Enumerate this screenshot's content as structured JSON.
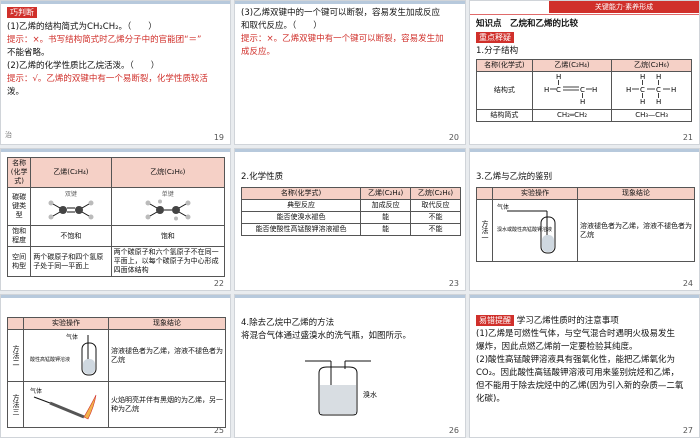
{
  "slides": [
    {
      "num": "19",
      "tag": "巧判断",
      "lines": [
        "(1)乙烯的结构简式为CH₂CH₂。（　　）",
        "提示：×。书写结构简式时乙烯分子中的官能团“＝”",
        "不能省略。",
        "(2)乙烯的化学性质比乙烷活泼。（　　）",
        "提示：√。乙烯的双键中有一个易断裂，化学性质较活",
        "泼。"
      ],
      "corner": "治"
    },
    {
      "num": "20",
      "lines": [
        "(3)乙烯双键中的一个键可以断裂，容易发生加成反应",
        "和取代反应。（　　）",
        "提示：×。乙烯双键中有一个键可以断裂，容易发生加",
        "成反应。"
      ]
    },
    {
      "num": "21",
      "banner": "关键能力·素养形成",
      "heading": "知识点　乙烷和乙烯的比较",
      "tag": "重点释疑",
      "sub": "1.分子结构",
      "table": {
        "headers": [
          "名称(化学式)",
          "乙烯(C₂H₄)",
          "乙烷(C₂H₆)"
        ],
        "rows": [
          [
            "结构式",
            "",
            ""
          ],
          [
            "结构简式",
            "CH₂═CH₂",
            "CH₃—CH₃"
          ]
        ]
      }
    },
    {
      "num": "22",
      "table": {
        "headers": [
          "名称(化学式)",
          "乙烯(C₂H₄)",
          "乙烷(C₂H₆)"
        ],
        "rows": [
          [
            "碳碳键类型",
            "",
            ""
          ],
          [
            "饱和程度",
            "不饱和",
            "饱和"
          ],
          [
            "空间构型",
            "两个碳原子和四个氢原子处于同一平面上",
            "两个碳原子和六个氢原子不在同一平面上，以每个碳原子为中心形成四面体结构"
          ]
        ],
        "model_labels": [
          "双键",
          "单键"
        ]
      }
    },
    {
      "num": "23",
      "sub": "2.化学性质",
      "table": {
        "headers": [
          "名称(化学式)",
          "乙烯(C₂H₄)",
          "乙烷(C₂H₆)"
        ],
        "rows": [
          [
            "典型反应",
            "加成反应",
            "取代反应"
          ],
          [
            "能否使溴水褪色",
            "能",
            "不能"
          ],
          [
            "能否使酸性高锰酸钾溶液褪色",
            "能",
            "不能"
          ]
        ]
      }
    },
    {
      "num": "24",
      "sub": "3.乙烯与乙烷的鉴别",
      "table": {
        "headers": [
          "",
          "实验操作",
          "现象结论"
        ],
        "rows": [
          [
            "方法一",
            "",
            "溶液褪色者为乙烯，溶液不褪色者为乙烷"
          ]
        ],
        "labels": [
          "气体",
          "溴水或酸性高锰酸钾溶液"
        ]
      }
    },
    {
      "num": "25",
      "table": {
        "headers": [
          "",
          "实验操作",
          "现象结论"
        ],
        "rows": [
          [
            "方法二",
            "",
            "溶液褪色者为乙烯，溶液不褪色者为乙烷"
          ],
          [
            "方法三",
            "",
            "火焰明亮并伴有黑烟的为乙烯，另一种为乙烷"
          ]
        ],
        "labels": [
          "气体",
          "酸性高锰酸钾溶液",
          "气体"
        ]
      }
    },
    {
      "num": "26",
      "lines": [
        "4.除去乙烷中乙烯的方法",
        "将混合气体通过盛溴水的洗气瓶，如图所示。"
      ],
      "label": "溴水"
    },
    {
      "num": "27",
      "tag": "易错提醒",
      "lines": [
        "学习乙烯性质时的注意事项",
        "(1)乙烯是可燃性气体，与空气混合时遇明火极易发生",
        "爆炸，因此点燃乙烯前一定要检验其纯度。",
        "(2)酸性高锰酸钾溶液具有强氧化性，能把乙烯氧化为",
        "CO₂。因此酸性高锰酸钾溶液可用来鉴别烷烃和乙烯，",
        "但不能用于除去烷烃中的乙烯(因为引入新的杂质—二氧",
        "化碳)。"
      ]
    }
  ]
}
